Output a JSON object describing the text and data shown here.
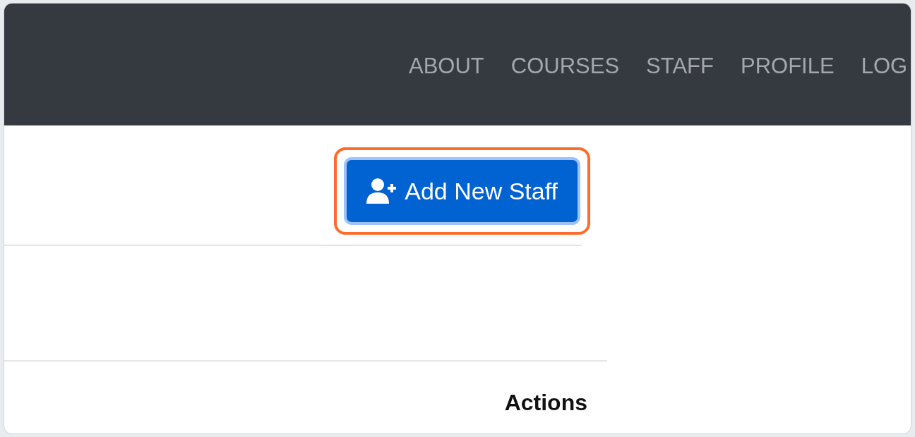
{
  "navbar": {
    "items": [
      "ABOUT",
      "COURSES",
      "STAFF",
      "PROFILE",
      "LOG"
    ]
  },
  "add_button": {
    "label": "Add New Staff",
    "highlighted": true
  },
  "table": {
    "columns": [
      "Actions"
    ]
  }
}
